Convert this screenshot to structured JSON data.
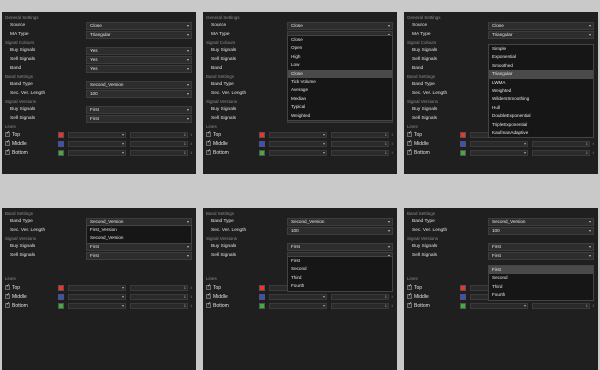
{
  "colors": {
    "panel_bg": "#1f1f1f",
    "control_bg": "#2d2d2d",
    "dropdown_bg": "#161616",
    "highlight": "#4a4a4a",
    "text": "#e6e6e6",
    "section": "#8c8c8c",
    "swatch_top": "#ff2a2a",
    "swatch_middle": "#3a4bd4",
    "swatch_bottom": "#3fae3f"
  },
  "panels": [
    {
      "sections": {
        "general": "General Settings",
        "signal_colours": "Signal Colours",
        "band": "Band Settings",
        "signal_versions": "Signal Versions",
        "lines": "Lines"
      },
      "fields": {
        "source": {
          "label": "Source",
          "value": "Close"
        },
        "ma_type": {
          "label": "MA Type",
          "value": "Triangular"
        },
        "buy_signals": {
          "label": "Buy Signals",
          "value": "Yes"
        },
        "sell_signals": {
          "label": "Sell Signals",
          "value": "Yes"
        },
        "band": {
          "label": "Band",
          "value": "Yes"
        },
        "band_type": {
          "label": "Band Type",
          "value": "Second_Version"
        },
        "sec_ver_length": {
          "label": "Sec. Ver. Length",
          "value": "100"
        },
        "buy_signals_v": {
          "label": "Buy Signals",
          "value": "First"
        },
        "sell_signals_v": {
          "label": "Sell Signals",
          "value": "First"
        }
      },
      "lines": {
        "top": "Top",
        "middle": "Middle",
        "bottom": "Bottom",
        "width": "1"
      }
    },
    {
      "sections": {
        "general": "General Settings",
        "signal_colours": "Signal Colours",
        "band": "Band Settings",
        "signal_versions": "Signal Versions",
        "lines": "Lines"
      },
      "fields": {
        "source": {
          "label": "Source",
          "value": "Close"
        },
        "ma_type": {
          "label": "MA Type",
          "value": ""
        },
        "buy_signals": {
          "label": "Buy Signals",
          "value": ""
        },
        "sell_signals": {
          "label": "Sell Signals",
          "value": ""
        },
        "band": {
          "label": "Band",
          "value": ""
        },
        "band_type": {
          "label": "Band Type",
          "value": ""
        },
        "sec_ver_length": {
          "label": "Sec. Ver. Length",
          "value": "100"
        },
        "buy_signals_v": {
          "label": "Buy Signals",
          "value": "First"
        },
        "sell_signals_v": {
          "label": "Sell Signals",
          "value": "First"
        }
      },
      "dropdown": [
        "Close",
        "Open",
        "High",
        "Low",
        "Close",
        "Tick Volume",
        "Average",
        "Median",
        "Typical",
        "Weighted"
      ],
      "lines": {
        "top": "Top",
        "middle": "Middle",
        "bottom": "Bottom",
        "width": "1"
      }
    },
    {
      "sections": {
        "general": "General Settings",
        "signal_colours": "Signal Colours",
        "band": "Band Settings",
        "signal_versions": "Signal Versions",
        "lines": "Lines"
      },
      "fields": {
        "source": {
          "label": "Source",
          "value": "Close"
        },
        "ma_type": {
          "label": "MA Type",
          "value": "Triangular"
        },
        "buy_signals": {
          "label": "Buy Signals",
          "value": ""
        },
        "sell_signals": {
          "label": "Sell Signals",
          "value": ""
        },
        "band": {
          "label": "Band",
          "value": ""
        },
        "band_type": {
          "label": "Band Type",
          "value": ""
        },
        "sec_ver_length": {
          "label": "Sec. Ver. Length",
          "value": ""
        },
        "buy_signals_v": {
          "label": "Buy Signals",
          "value": "First"
        },
        "sell_signals_v": {
          "label": "Sell Signals",
          "value": "First"
        }
      },
      "dropdown": [
        "Simple",
        "Exponential",
        "Smoothed",
        "Triangular",
        "LWMA",
        "Weighted",
        "WildersSmoothing",
        "Hull",
        "DoubleExponential",
        "TripleExponential",
        "KaufmanAdaptive"
      ],
      "lines": {
        "top": "Top",
        "middle": "Middle",
        "bottom": "Bottom",
        "width": "1"
      }
    },
    {
      "sections": {
        "band": "Band Settings",
        "signal_versions": "Signal Versions",
        "lines": "Lines"
      },
      "fields": {
        "band_type": {
          "label": "Band Type",
          "value": "Second_Version"
        },
        "sec_ver_length": {
          "label": "Sec. Ver. Length",
          "value": ""
        },
        "buy_signals_v": {
          "label": "Buy Signals",
          "value": "First"
        },
        "sell_signals_v": {
          "label": "Sell Signals",
          "value": "First"
        }
      },
      "dropdown": [
        "First_Version",
        "Second_Version"
      ],
      "lines": {
        "top": "Top",
        "middle": "Middle",
        "bottom": "Bottom",
        "width": "1"
      }
    },
    {
      "sections": {
        "band": "Band Settings",
        "signal_versions": "Signal Versions",
        "lines": "Lines"
      },
      "fields": {
        "band_type": {
          "label": "Band Type",
          "value": "Second_Version"
        },
        "sec_ver_length": {
          "label": "Sec. Ver. Length",
          "value": "100"
        },
        "buy_signals_v": {
          "label": "Buy Signals",
          "value": "First"
        },
        "sell_signals_v": {
          "label": "Sell Signals",
          "value": ""
        }
      },
      "dropdown": [
        "First",
        "Second",
        "Third",
        "Fourth"
      ],
      "lines": {
        "top": "Top",
        "middle": "Middle",
        "bottom": "Bottom",
        "width": "1"
      }
    },
    {
      "sections": {
        "band": "Band Settings",
        "signal_versions": "Signal Versions",
        "lines": "Lines"
      },
      "fields": {
        "band_type": {
          "label": "Band Type",
          "value": "Second_Version"
        },
        "sec_ver_length": {
          "label": "Sec. Ver. Length",
          "value": "100"
        },
        "buy_signals_v": {
          "label": "Buy Signals",
          "value": "First"
        },
        "sell_signals_v": {
          "label": "Sell Signals",
          "value": "First"
        }
      },
      "dropdown": [
        "First",
        "Second",
        "Third",
        "Fourth"
      ],
      "lines": {
        "top": "Top",
        "middle": "Middle",
        "bottom": "Bottom",
        "width": "1"
      }
    }
  ]
}
